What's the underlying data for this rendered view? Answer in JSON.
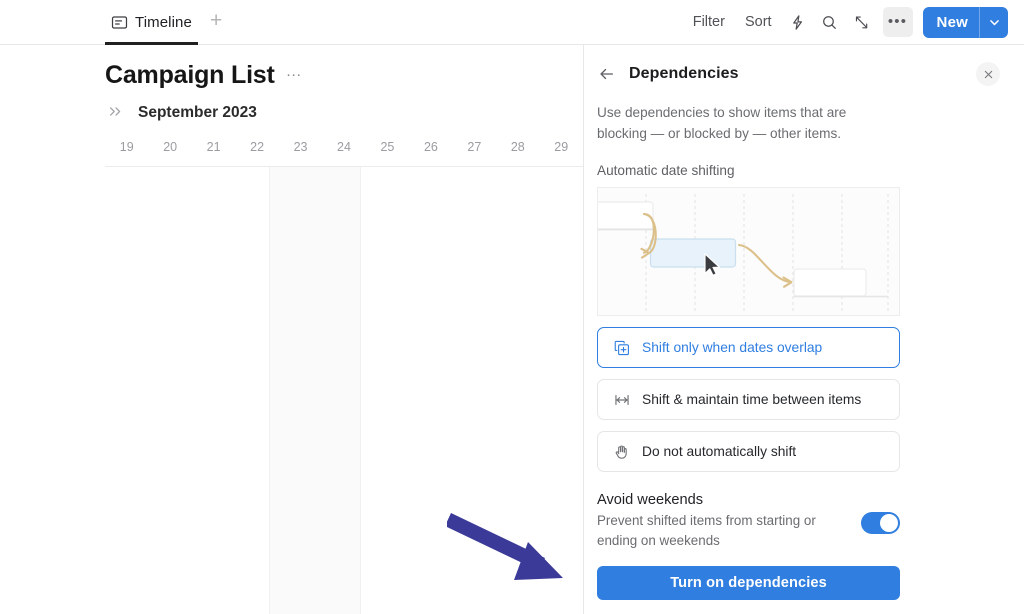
{
  "topbar": {
    "tabs": [
      {
        "label": "Timeline",
        "icon": "timeline-board-icon",
        "active": true
      }
    ],
    "add_tab_label": "+",
    "tools": [
      {
        "label": "Filter",
        "name": "filter-button"
      },
      {
        "label": "Sort",
        "name": "sort-button"
      }
    ],
    "icons": [
      {
        "name": "automation-bolt-icon",
        "glyph": "bolt"
      },
      {
        "name": "search-icon",
        "glyph": "magnifier"
      },
      {
        "name": "expand-icon",
        "glyph": "expand-arrows"
      },
      {
        "name": "more-options-icon",
        "glyph": "ellipsis"
      }
    ],
    "new_button": {
      "label": "New",
      "chevron": "chevron-down-icon"
    }
  },
  "left_panel": {
    "board_title": "Campaign List",
    "board_menu": "…",
    "month": "September 2023",
    "collapse_icon": "double-chevron-right-icon",
    "days": [
      "19",
      "20",
      "21",
      "22",
      "23",
      "24",
      "25",
      "26",
      "27",
      "28",
      "29"
    ],
    "weekend_days": [
      "23",
      "24"
    ]
  },
  "right_panel": {
    "back_icon": "back-arrow-icon",
    "title": "Dependencies",
    "close_icon": "close-icon",
    "description": "Use dependencies to show items that are blocking — or blocked by — other items.",
    "section_label": "Automatic date shifting",
    "illustration": {
      "name": "automatic-date-shifting-illustration",
      "cursor": "mouse-cursor",
      "arrow_color": "#dcc08a",
      "highlight_bar_fill": "#e8f2fa",
      "highlight_bar_border": "#c3dcee"
    },
    "options": [
      {
        "label": "Shift only when dates overlap",
        "icon": "copy-plus-icon",
        "selected": true
      },
      {
        "label": "Shift & maintain time between items",
        "icon": "spacing-between-icon",
        "selected": false
      },
      {
        "label": "Do not automatically shift",
        "icon": "stop-hand-icon",
        "selected": false
      }
    ],
    "avoid_weekends": {
      "title": "Avoid weekends",
      "subtitle": "Prevent shifted items from starting or ending on weekends",
      "toggle_on": true
    },
    "cta_label": "Turn on dependencies"
  },
  "annotation": {
    "name": "purple-pointer-arrow",
    "color": "#3b3a98",
    "points_to": "Turn on dependencies"
  },
  "colors": {
    "accent_blue": "#2f7ee0",
    "annotation_purple": "#3b3a98",
    "text_primary": "#1f2124",
    "text_muted": "#6a6c70"
  }
}
